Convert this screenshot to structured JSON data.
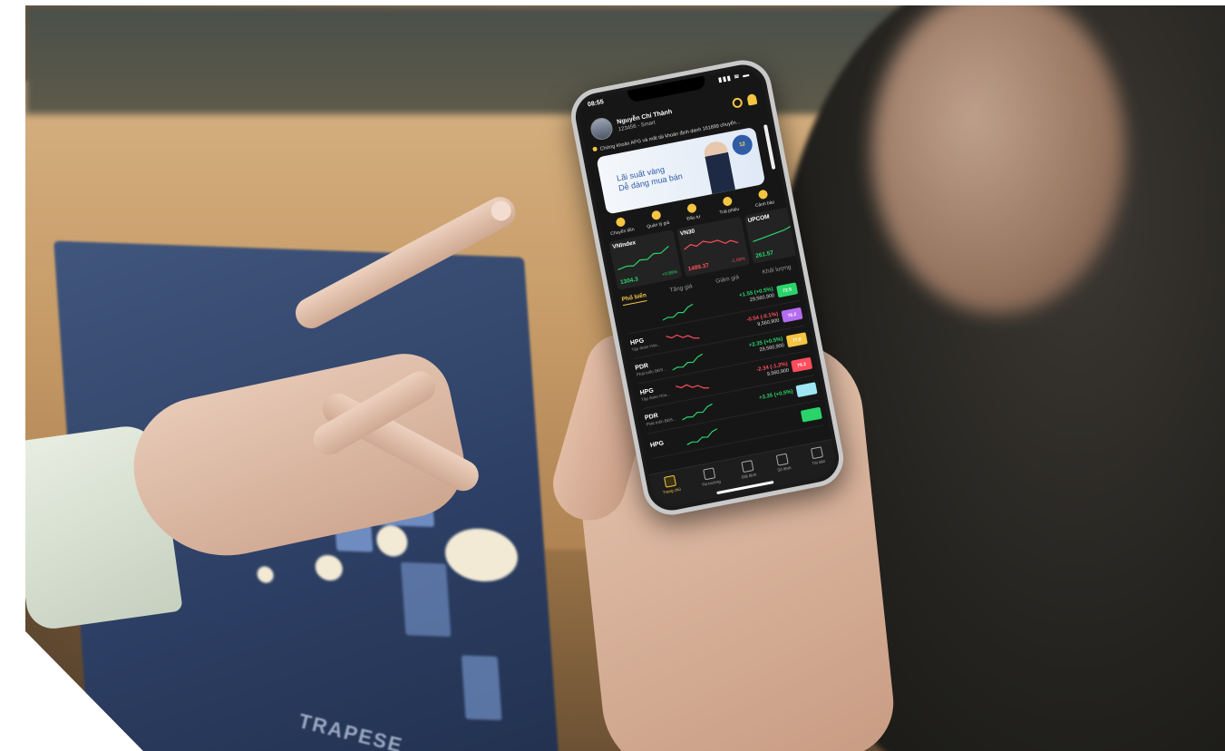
{
  "phone": {
    "status": {
      "time": "08:55",
      "signal": "▮▮▮ ≋ ▬"
    },
    "user": {
      "name": "Nguyễn Chí Thành",
      "account": "123456 - Smart"
    },
    "ticker": "Chứng khoán APG và mất tài khoản định danh 161899 chuyển...",
    "banner": {
      "line1": "Lãi suất vàng",
      "line2": "Dễ dàng mua bán",
      "badge": "12"
    },
    "quick_actions": [
      "Chuyển tiền",
      "Quản lý giá",
      "Đầu tư",
      "Trái phiếu",
      "Cảnh báo"
    ],
    "index_cards": [
      {
        "name": "VNIndex",
        "value": "1304.3",
        "change": "+0.89%",
        "direction": "up"
      },
      {
        "name": "VN30",
        "value": "1489.37",
        "change": "-1.09%",
        "direction": "down"
      },
      {
        "name": "UPCOM",
        "value": "261.57",
        "change": "",
        "direction": "up"
      }
    ],
    "tabs": [
      "Phổ biến",
      "Tăng giá",
      "Giảm giá",
      "Khối lượng"
    ],
    "active_tab": "Phổ biến",
    "stocks": [
      {
        "symbol": "",
        "desc": "",
        "change": "+1.55 (+0.5%)",
        "volume": "29,560,900",
        "tag": "72.5",
        "tag_color": "#2ad46a",
        "dir": "up"
      },
      {
        "symbol": "HPG",
        "desc": "Tập đoàn Hòa...",
        "change": "-0.54 (-0.1%)",
        "volume": "9,560,900",
        "tag": "76.2",
        "tag_color": "#b46cf0",
        "dir": "down"
      },
      {
        "symbol": "PDR",
        "desc": "Phát triển BĐS...",
        "change": "+2.35 (+0.5%)",
        "volume": "29,560,900",
        "tag": "77.8",
        "tag_color": "#f5c542",
        "dir": "up"
      },
      {
        "symbol": "HPG",
        "desc": "Tập đoàn Hòa...",
        "change": "-2.34 (-1.2%)",
        "volume": "9,560,900",
        "tag": "76.2",
        "tag_color": "#ff4d5c",
        "dir": "down"
      },
      {
        "symbol": "PDR",
        "desc": "Phát triển BĐS...",
        "change": "+3.35 (+0.5%)",
        "volume": "",
        "tag": "",
        "tag_color": "#9fe6f5",
        "dir": "up"
      },
      {
        "symbol": "HPG",
        "desc": "",
        "change": "",
        "volume": "",
        "tag": "",
        "tag_color": "#2ad46a",
        "dir": "up"
      }
    ],
    "nav": [
      "Trang chủ",
      "Thị trường",
      "Đặt lệnh",
      "Sổ lệnh",
      "Tài sản"
    ],
    "nav_active": "Trang chủ"
  },
  "booklet": {
    "caption": "TRAPESE"
  },
  "colors": {
    "accent": "#f5c542",
    "up": "#2ad46a",
    "down": "#ff4d5c",
    "screen_bg": "#161616"
  }
}
